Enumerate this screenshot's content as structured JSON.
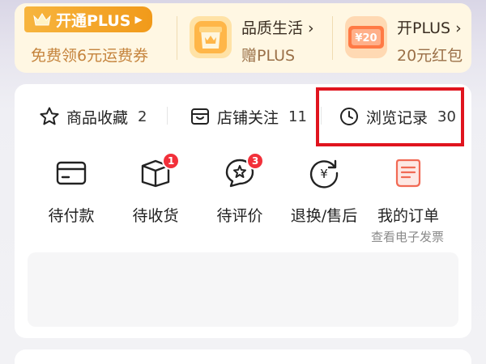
{
  "plus_banner": {
    "title": "开通PLUS",
    "subtitle": "免费领6元运费券",
    "promos": [
      {
        "title": "品质生活 ›",
        "subtitle": "赠PLUS",
        "icon": "gift-box-icon"
      },
      {
        "title": "开PLUS ›",
        "subtitle": "20元红包",
        "icon": "coupon-icon",
        "icon_text": "¥20"
      }
    ]
  },
  "stats": [
    {
      "label": "商品收藏",
      "count": "2",
      "icon": "star-icon"
    },
    {
      "label": "店铺关注",
      "count": "11",
      "icon": "store-icon"
    },
    {
      "label": "浏览记录",
      "count": "30",
      "icon": "clock-icon"
    }
  ],
  "orders": [
    {
      "label": "待付款",
      "icon": "wallet-card-icon",
      "badge": ""
    },
    {
      "label": "待收货",
      "icon": "package-icon",
      "badge": "1"
    },
    {
      "label": "待评价",
      "icon": "review-bubble-icon",
      "badge": "3"
    },
    {
      "label": "退换/售后",
      "icon": "refund-yen-icon",
      "badge": ""
    },
    {
      "label": "我的订单",
      "icon": "order-list-icon",
      "badge": ""
    }
  ],
  "invoice_link": "查看电子发票",
  "colors": {
    "accent_orange": "#f19a1a",
    "badge_red": "#f2303a",
    "highlight_red": "#e0141e",
    "plus_text": "#c5843d"
  }
}
